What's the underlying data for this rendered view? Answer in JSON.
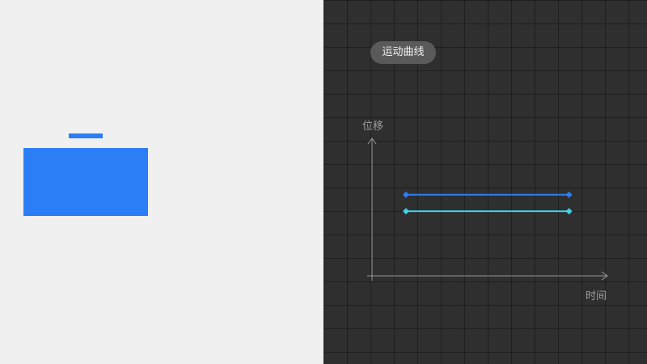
{
  "chart_label": "运动曲线",
  "colors": {
    "accent": "#2b7ef6",
    "cyan": "#3fd2e6",
    "left_bg": "#f0f0f0",
    "right_bg": "#2f2f2f",
    "axis": "#9a9a9a"
  },
  "chart_data": {
    "type": "line",
    "title": "",
    "xlabel": "时间",
    "ylabel": "位移",
    "grid": true,
    "xlim": [
      0,
      1
    ],
    "ylim": [
      0,
      1
    ],
    "series": [
      {
        "color": "#2b7ef6",
        "x": [
          0.15,
          0.87
        ],
        "y": [
          0.59,
          0.59
        ]
      },
      {
        "color": "#3fd2e6",
        "x": [
          0.15,
          0.87
        ],
        "y": [
          0.47,
          0.47
        ]
      }
    ]
  }
}
